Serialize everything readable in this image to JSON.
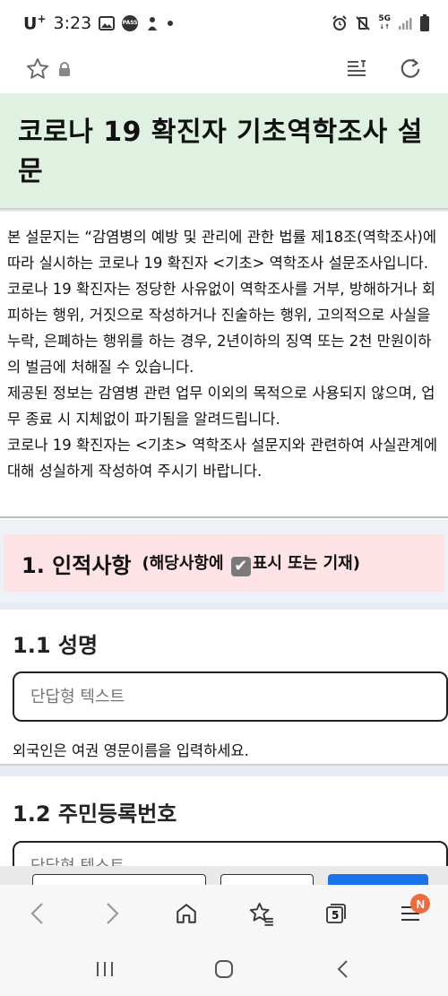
{
  "status_bar": {
    "carrier": "U",
    "carrier_sup": "+",
    "time": "3:23",
    "pass_badge": "PASS",
    "net_label": "5G"
  },
  "browser_bar": {
    "icons": [
      "star-icon",
      "lock-icon",
      "reader-mode-icon",
      "refresh-icon"
    ]
  },
  "form": {
    "title": "코로나 19 확진자 기초역학조사 설문",
    "intro": [
      "본 설문지는 “감염병의 예방 및 관리에 관한 법률 제18조(역학조사)에 따라 실시하는 코로나 19 확진자 <기초> 역학조사 설문조사입니다.",
      "코로나 19 확진자는 정당한 사유없이 역학조사를 거부, 방해하거나 회피하는 행위, 거짓으로 작성하거나 진술하는 행위, 고의적으로 사실을 누락, 은폐하는 행위를 하는 경우, 2년이하의 징역 또는 2천 만원이하의 벌금에 처해질 수 있습니다.",
      "제공된 정보는 감염병 관련 업무 이외의 목적으로 사용되지 않으며, 업무 종료 시 지체없이 파기됨을 알려드립니다.",
      "코로나 19 확진자는 <기초> 역학조사 설문지와 관련하여 사실관계에 대해 성실하게 작성하여 주시기 바랍니다."
    ],
    "section": {
      "number_title": "1. 인적사항",
      "note_prefix": "(해당사항에 ",
      "note_check": "✔",
      "note_suffix": "표시 또는 기재)"
    },
    "questions": [
      {
        "title": "1.1 성명",
        "placeholder": "단답형 텍스트",
        "help": "외국인은 여권 영문이름을 입력하세요."
      },
      {
        "title": "1.2 주민등록번호",
        "placeholder": "단답형 텍스트"
      }
    ]
  },
  "bottom_nav": {
    "tab_count": "5",
    "menu_badge": "N",
    "items": [
      "back-icon",
      "forward-icon",
      "home-icon",
      "bookmarks-icon",
      "tabs-icon",
      "menu-icon"
    ]
  },
  "colors": {
    "title_bg": "#dff1e1",
    "section_bg": "#fde3e5",
    "primary_button": "#1a73e8",
    "badge": "#f26b3a"
  }
}
